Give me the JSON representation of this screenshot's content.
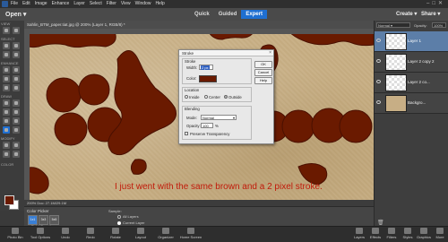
{
  "menu": {
    "items": [
      "File",
      "Edit",
      "Image",
      "Enhance",
      "Layer",
      "Select",
      "Filter",
      "View",
      "Window",
      "Help"
    ]
  },
  "modebar": {
    "open_label": "Open",
    "tabs": [
      "Quick",
      "Guided",
      "Expert"
    ],
    "active_tab": "Expert",
    "create_label": "Create",
    "share_label": "Share"
  },
  "toolbar": {
    "sections": [
      "VIEW",
      "SELECT",
      "ENHANCE",
      "DRAW",
      "MODIFY",
      "COLOR"
    ],
    "foreground_color": "#6a1a00",
    "background_color": "#ffffff"
  },
  "document": {
    "tab_title": "Sahlin_BTM_paper.tiat.jpg @ 200% (Layer 1, RGB/8) *",
    "status": "200%   Doc: 27.1M/29.1M",
    "caption": "I just went with the same brown and a 2 pixel stroke.",
    "shape_color": "#6a1a00"
  },
  "tool_options": {
    "title": "Color Picker",
    "sample_icons": [
      "1x1",
      "3x3",
      "5x5"
    ],
    "mode_label": "Point Sample",
    "sample_label": "Sample:",
    "sample_options": [
      "All Layers",
      "Current Layer"
    ],
    "sample_selected": 1
  },
  "layers": {
    "blend_mode": "Normal",
    "opacity_label": "Opacity:",
    "opacity_value": "100%",
    "rows": [
      {
        "name": "Layer 1",
        "active": true,
        "thumb": "transparent"
      },
      {
        "name": "Layer 2 copy 2",
        "active": false,
        "thumb": "transparent"
      },
      {
        "name": "Layer 2 co...",
        "active": false,
        "thumb": "transparent"
      },
      {
        "name": "Backgro...",
        "active": false,
        "thumb": "paper"
      }
    ]
  },
  "status_message": "Vintage Frame Brushes and Ornament Brush Pack",
  "taskbar": {
    "left": [
      "Photo Bin",
      "Tool Options",
      "Undo",
      "Redo",
      "Rotate",
      "Layout",
      "Organizer",
      "Home Screen"
    ],
    "right": [
      "Layers",
      "Effects",
      "Filters",
      "Styles",
      "Graphics",
      "More"
    ]
  },
  "stroke_dialog": {
    "title": "Stroke",
    "stroke_group": "Stroke",
    "width_label": "Width:",
    "width_value": "2 px",
    "color_label": "Color:",
    "color_value": "#6a1a00",
    "location_group": "Location",
    "location_options": [
      "Inside",
      "Center",
      "Outside"
    ],
    "location_selected": 2,
    "blending_group": "Blending",
    "mode_label": "Mode:",
    "mode_value": "Normal",
    "opacity_label": "Opacity:",
    "opacity_value": "100",
    "opacity_unit": "%",
    "preserve_label": "Preserve Transparency",
    "buttons": [
      "OK",
      "Cancel",
      "Help"
    ]
  }
}
